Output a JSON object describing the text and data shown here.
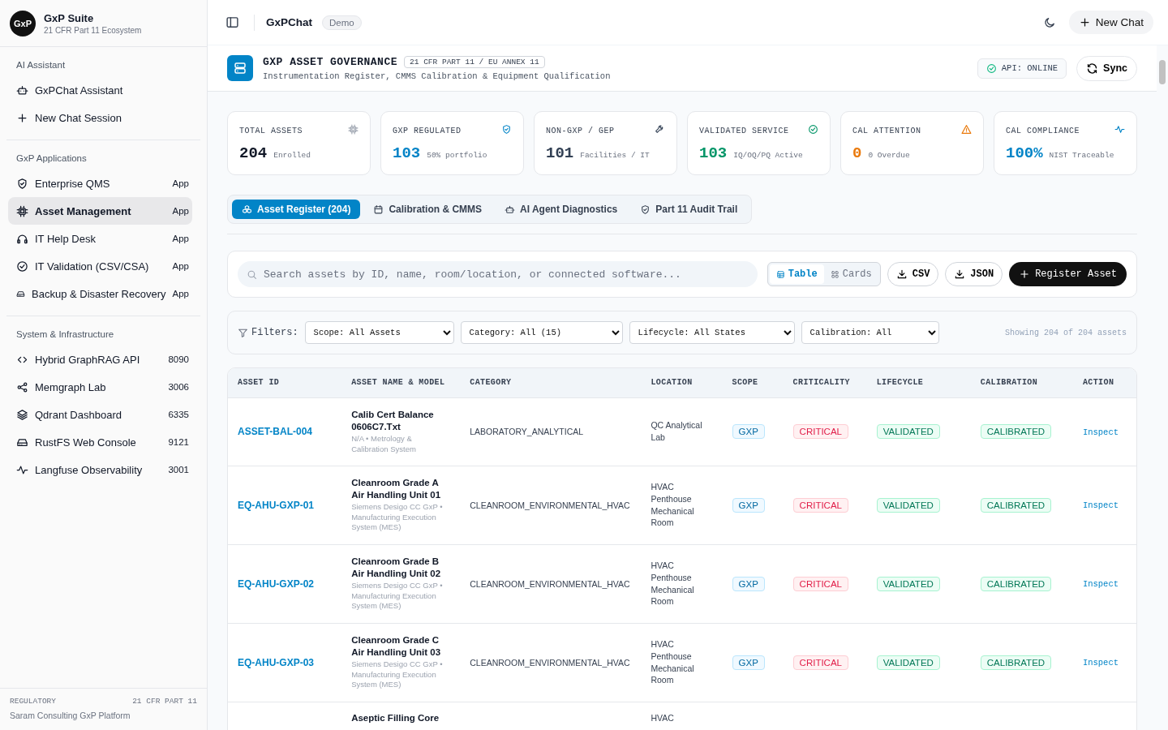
{
  "brand": {
    "logo": "GxP",
    "name": "GxP Suite",
    "subtitle": "21 CFR Part 11 Ecosystem"
  },
  "sidebar": {
    "sections": [
      {
        "title": "AI Assistant",
        "items": [
          {
            "kind": "bot",
            "label": "GxPChat Assistant",
            "selected": false
          },
          {
            "kind": "plus",
            "label": "New Chat Session",
            "selected": false
          }
        ]
      },
      {
        "title": "GxP Applications",
        "items": [
          {
            "kind": "shield",
            "label": "Enterprise QMS",
            "badge": "App",
            "selected": false
          },
          {
            "kind": "chip",
            "label": "Asset Management",
            "badge": "App",
            "selected": true
          },
          {
            "kind": "headphones",
            "label": "IT Help Desk",
            "badge": "App",
            "selected": false
          },
          {
            "kind": "check",
            "label": "IT Validation (CSV/CSA)",
            "badge": "App",
            "selected": false
          },
          {
            "kind": "drive",
            "label": "Backup & Disaster Recovery",
            "badge": "App",
            "selected": false
          }
        ]
      },
      {
        "title": "System & Infrastructure",
        "items": [
          {
            "kind": "code",
            "label": "Hybrid GraphRAG API",
            "badge": "8090",
            "selected": false
          },
          {
            "kind": "share",
            "label": "Memgraph Lab",
            "badge": "3006",
            "selected": false
          },
          {
            "kind": "layers",
            "label": "Qdrant Dashboard",
            "badge": "6335",
            "selected": false
          },
          {
            "kind": "drive",
            "label": "RustFS Web Console",
            "badge": "9121",
            "selected": false
          },
          {
            "kind": "pulse",
            "label": "Langfuse Observability",
            "badge": "3001",
            "selected": false
          }
        ]
      }
    ],
    "footer": {
      "label": "REGULATORY",
      "tag": "21 CFR PART 11",
      "text": "Saram Consulting GxP Platform"
    }
  },
  "topbar": {
    "title": "GxPChat",
    "badge": "Demo",
    "new_chat": "New Chat"
  },
  "header": {
    "title": "GXP ASSET GOVERNANCE",
    "tag": "21 CFR PART 11 / EU ANNEX 11",
    "subtitle": "Instrumentation Register, CMMS Calibration & Equipment Qualification",
    "api_status": "API: ONLINE",
    "sync": "Sync"
  },
  "stats": [
    {
      "label": "TOTAL ASSETS",
      "value": "204",
      "note": "Enrolled",
      "kind": "chip",
      "color": "#111827"
    },
    {
      "label": "GXP REGULATED",
      "value": "103",
      "note": "50% portfolio",
      "kind": "shield",
      "color": "#0284c7"
    },
    {
      "label": "NON-GXP / GEP",
      "value": "101",
      "note": "Facilities / IT",
      "kind": "wrench",
      "color": "#334155"
    },
    {
      "label": "VALIDATED SERVICE",
      "value": "103",
      "note": "IQ/OQ/PQ Active",
      "kind": "check",
      "color": "#059669"
    },
    {
      "label": "CAL ATTENTION",
      "value": "0",
      "note": "0 Overdue",
      "kind": "warning",
      "color": "#ea7a0c"
    },
    {
      "label": "CAL COMPLIANCE",
      "value": "100%",
      "note": "NIST Traceable",
      "kind": "pulse",
      "color": "#0284c7"
    }
  ],
  "tabs": [
    {
      "kind": "cubes",
      "label": "Asset Register (204)",
      "selected": true
    },
    {
      "kind": "calendar",
      "label": "Calibration & CMMS",
      "selected": false
    },
    {
      "kind": "bot",
      "label": "AI Agent Diagnostics",
      "selected": false
    },
    {
      "kind": "shield",
      "label": "Part 11 Audit Trail",
      "selected": false
    }
  ],
  "toolbar": {
    "search_placeholder": "Search assets by ID, name, room/location, or connected software...",
    "views": [
      {
        "kind": "table",
        "label": "Table",
        "selected": true
      },
      {
        "kind": "grid",
        "label": "Cards",
        "selected": false
      }
    ],
    "csv": "CSV",
    "json": "JSON",
    "register": "Register Asset"
  },
  "filters": {
    "label": "Filters:",
    "selects": [
      "Scope: All Assets",
      "Category: All (15)",
      "Lifecycle: All States",
      "Calibration: All"
    ],
    "showing": "Showing 204 of 204 assets"
  },
  "table": {
    "columns": [
      "ASSET ID",
      "ASSET NAME & MODEL",
      "CATEGORY",
      "LOCATION",
      "SCOPE",
      "CRITICALITY",
      "LIFECYCLE",
      "CALIBRATION",
      "ACTION"
    ],
    "rows": [
      {
        "id": "ASSET-BAL-004",
        "name": "Calib Cert Balance 0606C7.Txt",
        "model": "N/A • Metrology & Calibration System",
        "category": "LABORATORY_ANALYTICAL",
        "location": "QC Analytical Lab",
        "scope": "GXP",
        "criticality": "CRITICAL",
        "lifecycle": "VALIDATED",
        "calibration": "CALIBRATED",
        "action": "Inspect"
      },
      {
        "id": "EQ-AHU-GXP-01",
        "name": "Cleanroom Grade A Air Handling Unit 01",
        "model": "Siemens Desigo CC GxP • Manufacturing Execution System (MES)",
        "category": "CLEANROOM_ENVIRONMENTAL_HVAC",
        "location": "HVAC Penthouse Mechanical Room",
        "scope": "GXP",
        "criticality": "CRITICAL",
        "lifecycle": "VALIDATED",
        "calibration": "CALIBRATED",
        "action": "Inspect"
      },
      {
        "id": "EQ-AHU-GXP-02",
        "name": "Cleanroom Grade B Air Handling Unit 02",
        "model": "Siemens Desigo CC GxP • Manufacturing Execution System (MES)",
        "category": "CLEANROOM_ENVIRONMENTAL_HVAC",
        "location": "HVAC Penthouse Mechanical Room",
        "scope": "GXP",
        "criticality": "CRITICAL",
        "lifecycle": "VALIDATED",
        "calibration": "CALIBRATED",
        "action": "Inspect"
      },
      {
        "id": "EQ-AHU-GXP-03",
        "name": "Cleanroom Grade C Air Handling Unit 03",
        "model": "Siemens Desigo CC GxP • Manufacturing Execution System (MES)",
        "category": "CLEANROOM_ENVIRONMENTAL_HVAC",
        "location": "HVAC Penthouse Mechanical Room",
        "scope": "GXP",
        "criticality": "CRITICAL",
        "lifecycle": "VALIDATED",
        "calibration": "CALIBRATED",
        "action": "Inspect"
      },
      {
        "name": "Aseptic Filling Core",
        "location": "HVAC"
      }
    ]
  }
}
